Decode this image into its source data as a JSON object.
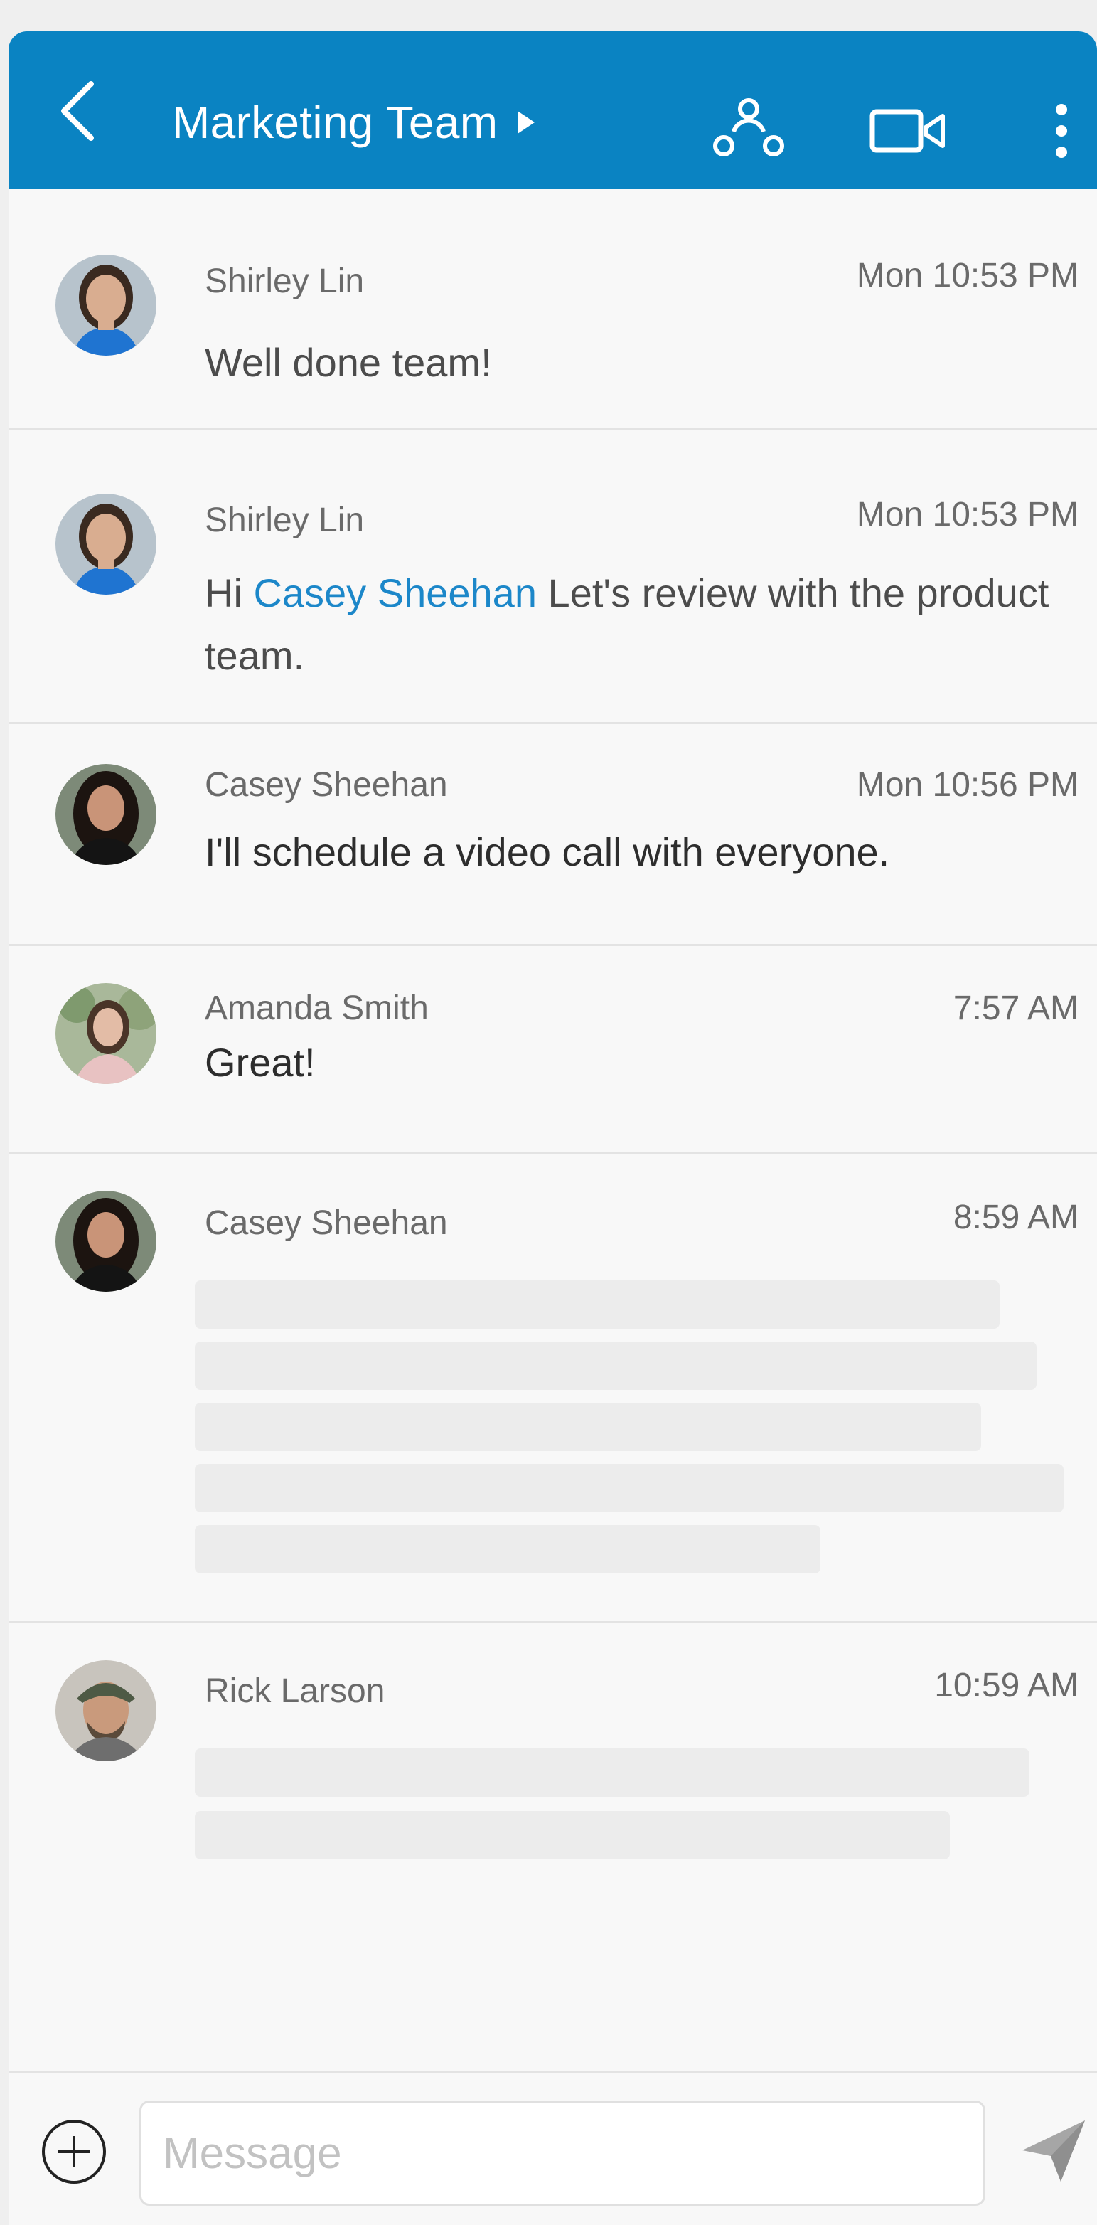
{
  "header": {
    "title": "Marketing Team"
  },
  "messages": [
    {
      "sender": "Shirley Lin",
      "time": "Mon 10:53 PM",
      "text": "Well done team!"
    },
    {
      "sender": "Shirley Lin",
      "time": "Mon 10:53 PM",
      "text_prefix": "Hi",
      "mention": "Casey Sheehan",
      "text_suffix": "Let's review with the product team."
    },
    {
      "sender": "Casey Sheehan",
      "time": "Mon 10:56 PM",
      "text": "I'll schedule a video call with everyone."
    },
    {
      "sender": "Amanda Smith",
      "time": "7:57 AM",
      "text": "Great!"
    },
    {
      "sender": "Casey Sheehan",
      "time": "8:59 AM"
    },
    {
      "sender": "Rick Larson",
      "time": "10:59 AM"
    }
  ],
  "composer": {
    "placeholder": "Message"
  },
  "icons": {
    "back": "chevron-left-icon",
    "caret": "triangle-right-icon",
    "people": "people-group-icon",
    "video": "video-camera-icon",
    "more": "more-vertical-icon",
    "add": "plus-circle-icon",
    "send": "paper-plane-icon"
  },
  "colors": {
    "header": "#0a83c2",
    "mention": "#1c87c9"
  }
}
